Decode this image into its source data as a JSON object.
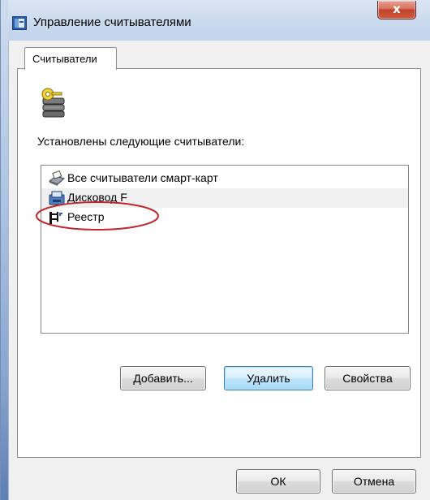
{
  "window": {
    "title": "Управление считывателями",
    "close_glyph": "x"
  },
  "tabs": [
    {
      "label": "Считыватели",
      "active": true
    }
  ],
  "panel": {
    "icon": "key-ring-icon",
    "installed_label": "Установлены следующие считыватели:",
    "readers": [
      {
        "label": "Все считыватели смарт-карт",
        "icon": "smart-card-reader-icon",
        "selected": false
      },
      {
        "label": "Дисковод F",
        "icon": "floppy-drive-icon",
        "selected": true,
        "highlighted": true
      },
      {
        "label": "Реестр",
        "icon": "registry-icon",
        "selected": false
      }
    ],
    "buttons": {
      "add": "Добавить...",
      "remove": "Удалить",
      "properties": "Свойства"
    }
  },
  "footer": {
    "ok": "ОК",
    "cancel": "Отмена"
  },
  "colors": {
    "highlight_circle": "#c0282c",
    "default_button_border": "#3c7fb1",
    "close_button": "#c2412b"
  }
}
